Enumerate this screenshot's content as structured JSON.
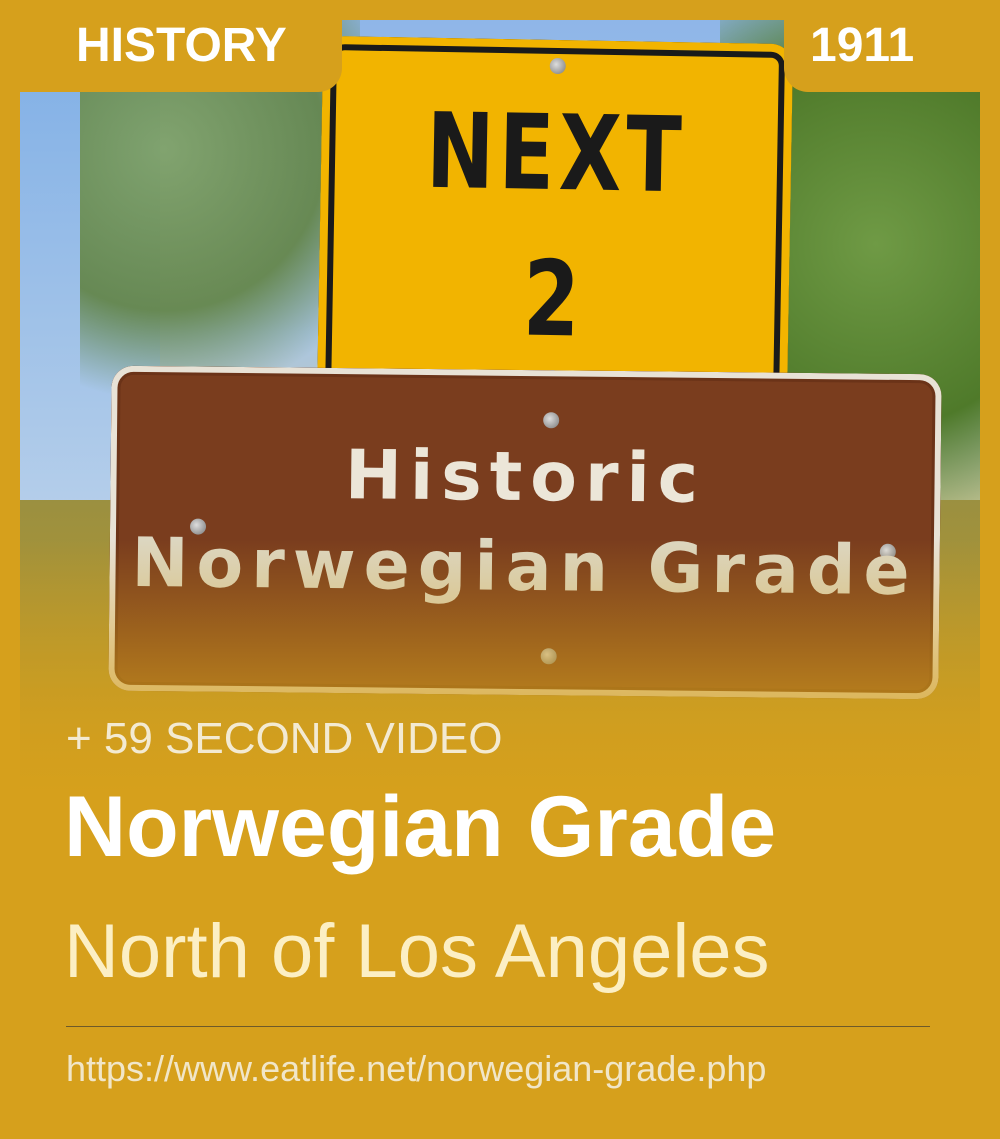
{
  "tags": {
    "category": "HISTORY",
    "year": "1911"
  },
  "photo": {
    "sign_top": {
      "line1": "NEXT",
      "line2": "2 MILES"
    },
    "sign_bottom": {
      "line1": "Historic",
      "line2": "Norwegian Grade"
    }
  },
  "overlay": {
    "video_label": "+ 59 SECOND VIDEO",
    "title": "Norwegian Grade",
    "subtitle": "North of Los Angeles",
    "url": "https://www.eatlife.net/norwegian-grade.php"
  },
  "colors": {
    "accent": "#d6a01c",
    "sign_yellow": "#f2b400",
    "sign_brown": "#7a3d1e"
  }
}
